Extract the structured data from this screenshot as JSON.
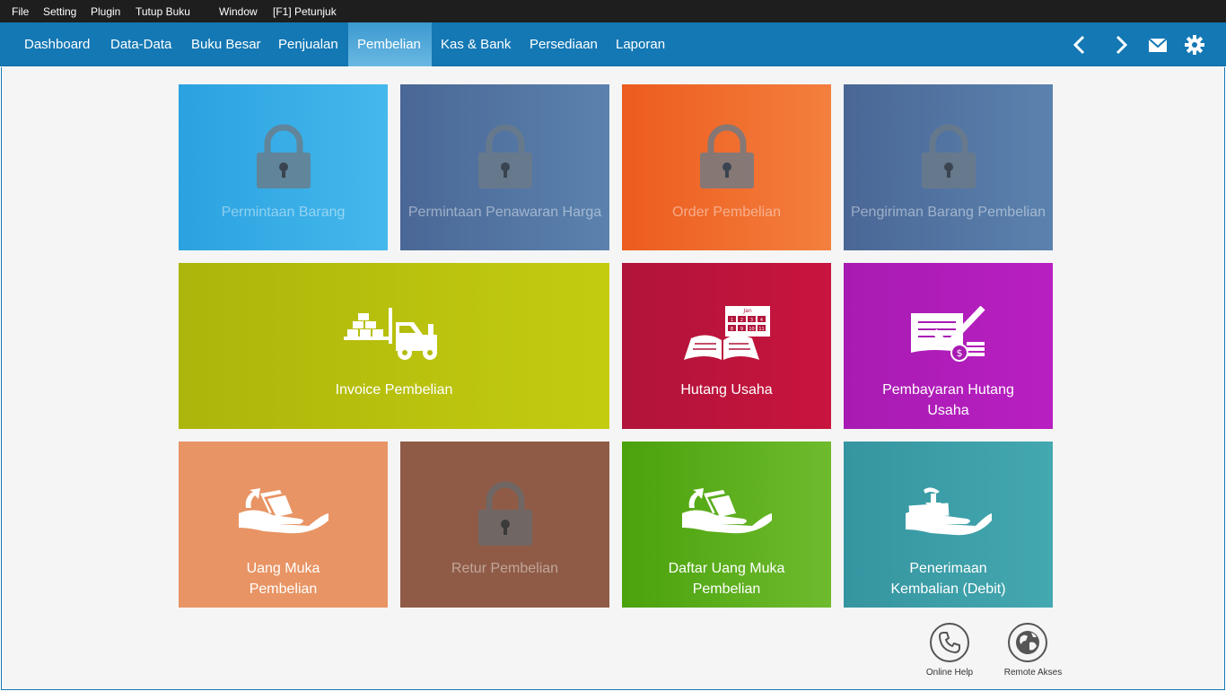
{
  "menubar": {
    "items": [
      "File",
      "Setting",
      "Plugin",
      "Tutup Buku",
      "Window",
      "[F1] Petunjuk"
    ]
  },
  "nav": {
    "items": [
      "Dashboard",
      "Data-Data",
      "Buku Besar",
      "Penjualan",
      "Pembelian",
      "Kas & Bank",
      "Persediaan",
      "Laporan"
    ],
    "active": "Pembelian"
  },
  "tiles": {
    "permintaan_barang": "Permintaan Barang",
    "permintaan_penawaran_harga": "Permintaan Penawaran Harga",
    "order_pembelian": "Order Pembelian",
    "pengiriman_barang_pembelian": "Pengiriman Barang Pembelian",
    "invoice_pembelian": "Invoice Pembelian",
    "hutang_usaha": "Hutang Usaha",
    "pembayaran_hutang_usaha_1": "Pembayaran Hutang",
    "pembayaran_hutang_usaha_2": "Usaha",
    "uang_muka_pembelian_1": "Uang Muka",
    "uang_muka_pembelian_2": "Pembelian",
    "retur_pembelian": "Retur Pembelian",
    "daftar_uang_muka_1": "Daftar Uang Muka",
    "daftar_uang_muka_2": "Pembelian",
    "penerimaan_kembalian_1": "Penerimaan",
    "penerimaan_kembalian_2": "Kembalian (Debit)"
  },
  "calendar": {
    "month": "Jan",
    "days": [
      "1",
      "2",
      "3",
      "4",
      "8",
      "9",
      "10",
      "11"
    ]
  },
  "footer": {
    "online_help": "Online Help",
    "remote_akses": "Remote Akses"
  },
  "colors": {
    "navbar": "#1478b4",
    "menubar": "#1e1e1e",
    "background": "#f5f5f5"
  }
}
